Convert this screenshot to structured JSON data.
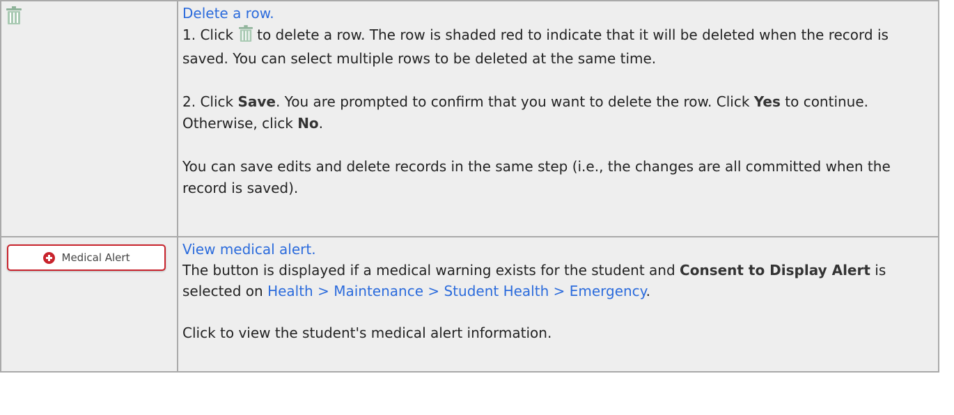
{
  "rows": [
    {
      "icon": "trash-icon",
      "title_link": "Delete a row.",
      "step1_prefix": "1. Click",
      "step1_suffix": "to delete a row. The row is shaded red to indicate that it will be deleted when the record is saved. You can select multiple rows to be deleted at the same time.",
      "step2_prefix": "2. Click ",
      "step2_bold_save": "Save",
      "step2_mid": ". You are prompted to confirm that you want to delete the row. Click ",
      "step2_bold_yes": "Yes",
      "step2_mid2": " to continue. Otherwise, click ",
      "step2_bold_no": "No",
      "step2_end": ".",
      "note": "You can save edits and delete records in the same step (i.e., the changes are all committed when the record is saved)."
    },
    {
      "button_label": "Medical Alert",
      "title_link": "View medical alert.",
      "desc_prefix": "The button is displayed if a medical warning exists for the student and ",
      "desc_bold": "Consent to Display Alert",
      "desc_mid": " is selected on ",
      "desc_link": "Health > Maintenance > Student Health > Emergency",
      "desc_end": ".",
      "note": "Click to view the student's medical alert information."
    }
  ],
  "colors": {
    "link": "#2b6bdc",
    "alert_red": "#c8232c",
    "trash_green": "#8fb39a"
  }
}
